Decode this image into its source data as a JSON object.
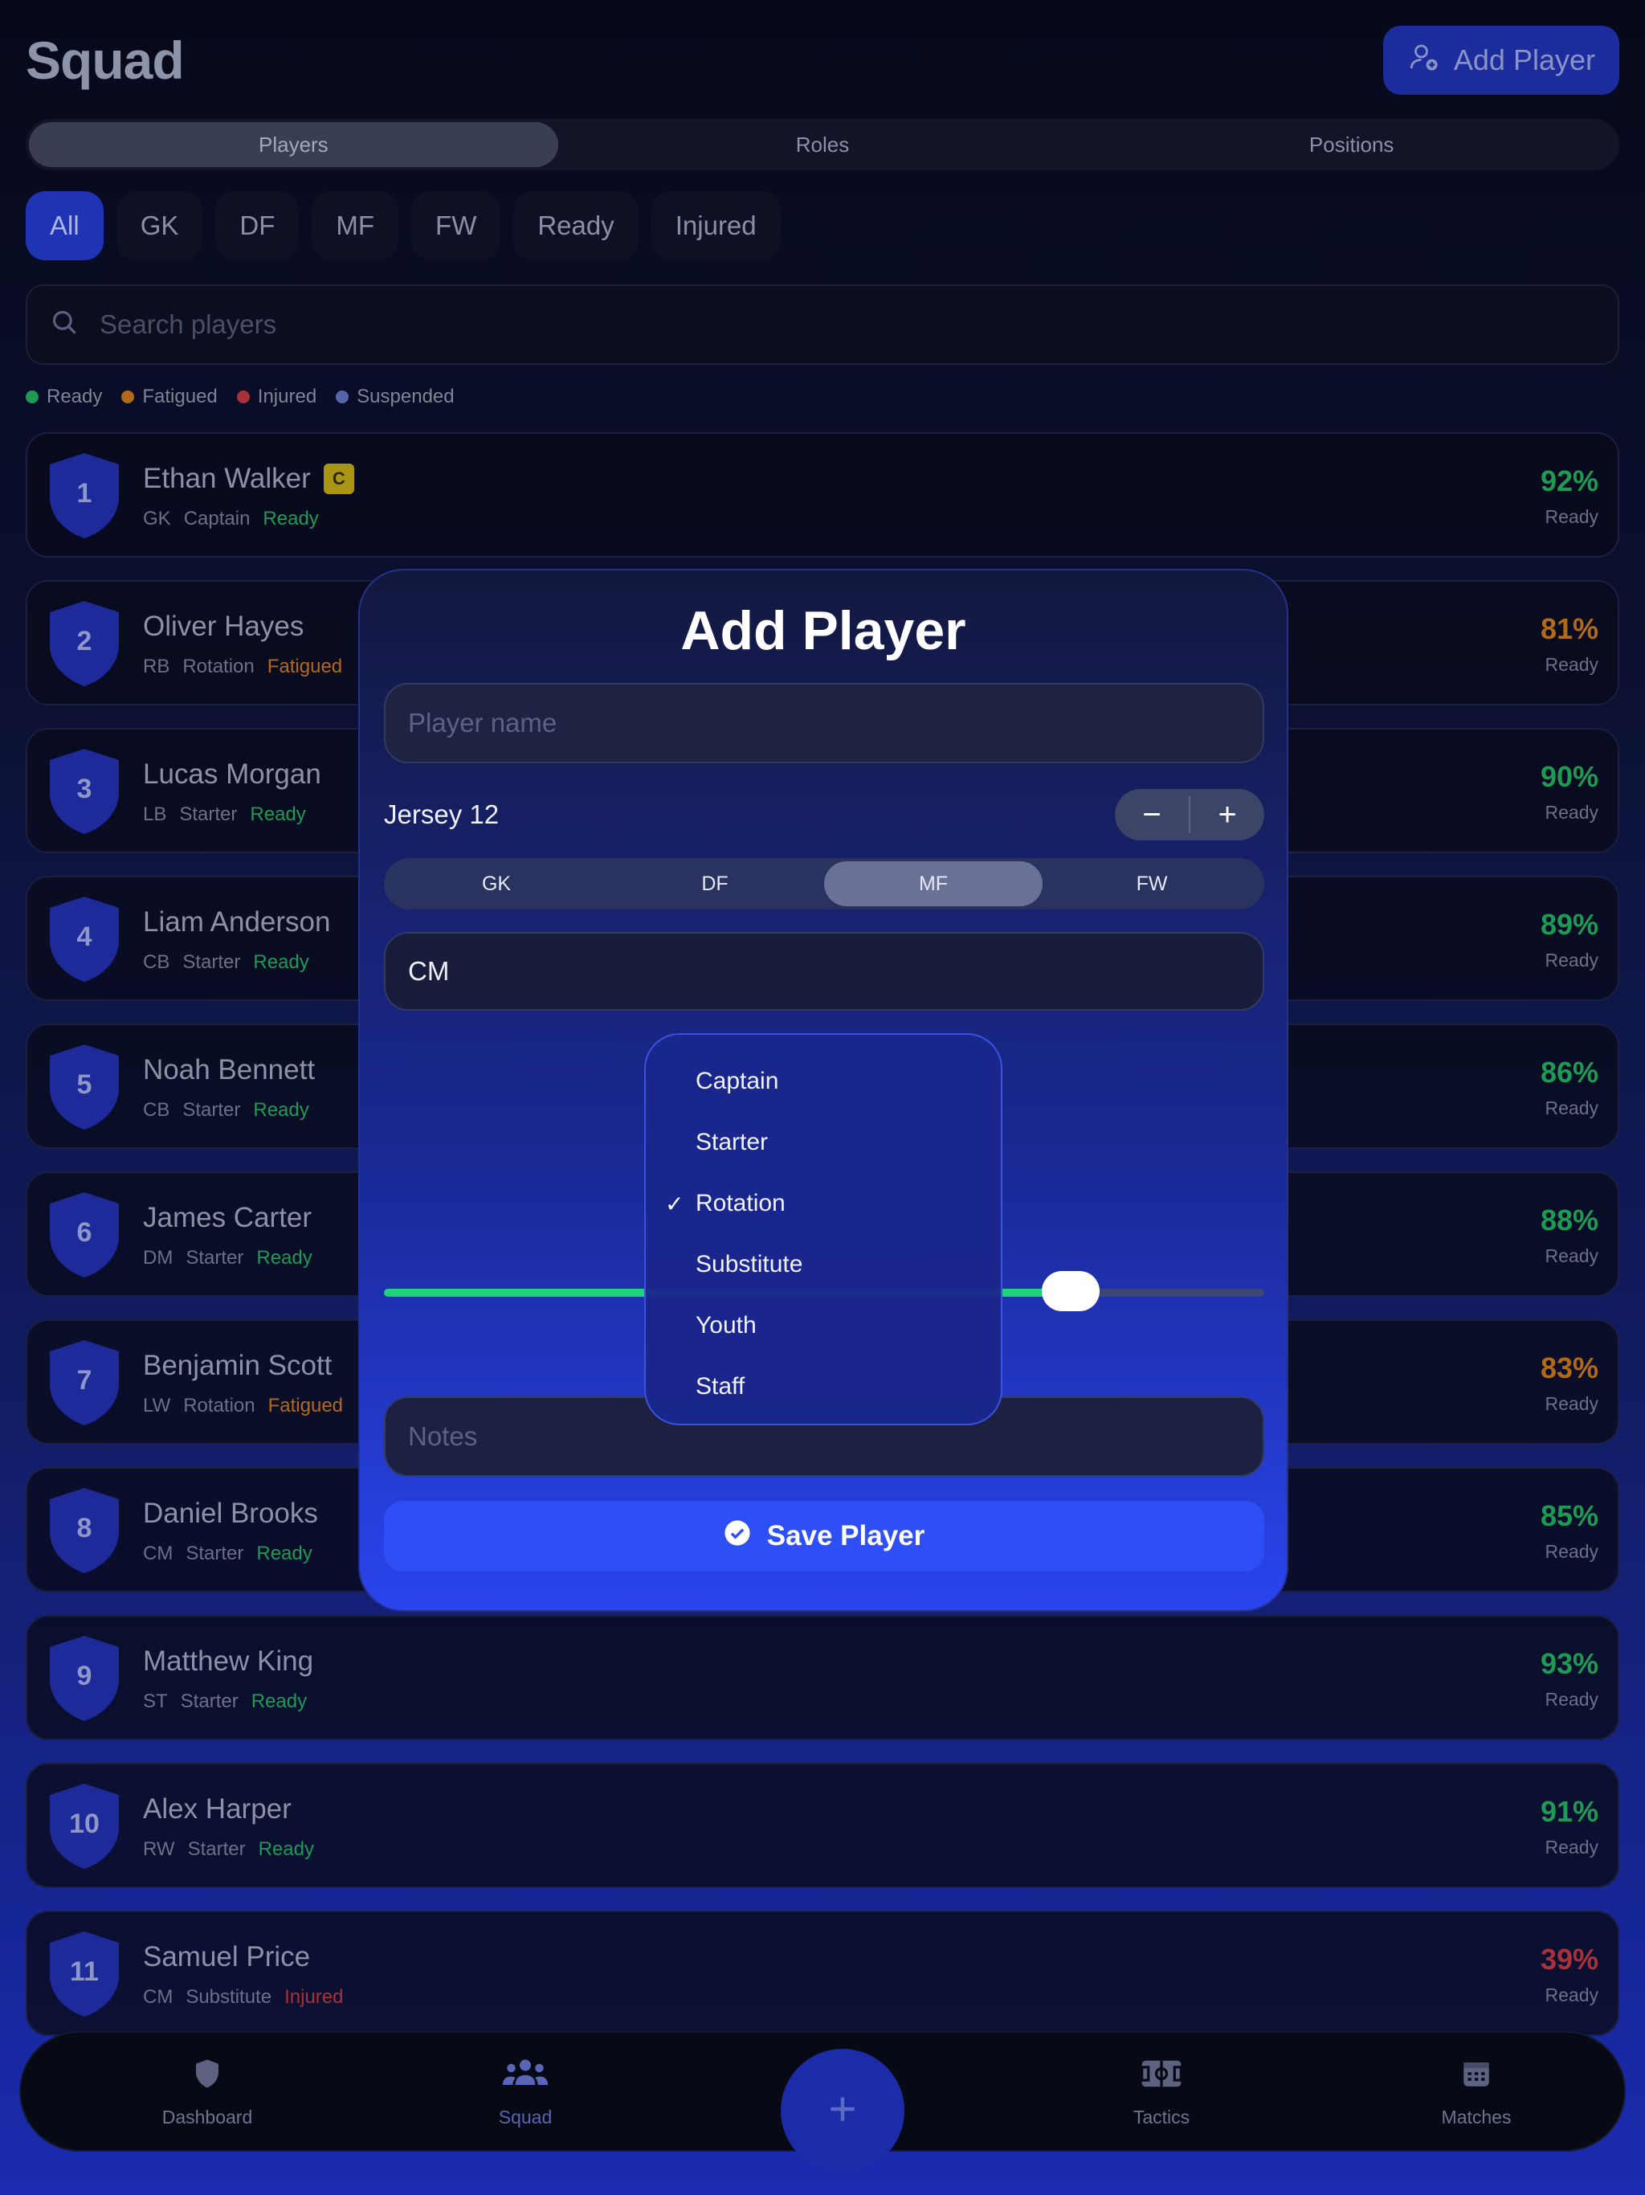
{
  "header": {
    "title": "Squad",
    "add_button_label": "Add Player"
  },
  "tabs": [
    "Players",
    "Roles",
    "Positions"
  ],
  "filters": [
    "All",
    "GK",
    "DF",
    "MF",
    "FW",
    "Ready",
    "Injured"
  ],
  "search": {
    "placeholder": "Search players"
  },
  "legend": [
    {
      "label": "Ready",
      "color": "#1f9a55"
    },
    {
      "label": "Fatigued",
      "color": "#b06a1a"
    },
    {
      "label": "Injured",
      "color": "#a8323a"
    },
    {
      "label": "Suspended",
      "color": "#5864a8"
    }
  ],
  "players": [
    {
      "number": "1",
      "name": "Ethan Walker",
      "badge": "C",
      "pos": "GK",
      "role": "Captain",
      "status": "Ready",
      "pct": "92%",
      "pct_label": "Ready"
    },
    {
      "number": "2",
      "name": "Oliver Hayes",
      "badge": "",
      "pos": "RB",
      "role": "Rotation",
      "status": "Fatigued",
      "pct": "81%",
      "pct_label": "Ready"
    },
    {
      "number": "3",
      "name": "Lucas Morgan",
      "badge": "",
      "pos": "LB",
      "role": "Starter",
      "status": "Ready",
      "pct": "90%",
      "pct_label": "Ready"
    },
    {
      "number": "4",
      "name": "Liam Anderson",
      "badge": "",
      "pos": "CB",
      "role": "Starter",
      "status": "Ready",
      "pct": "89%",
      "pct_label": "Ready"
    },
    {
      "number": "5",
      "name": "Noah Bennett",
      "badge": "",
      "pos": "CB",
      "role": "Starter",
      "status": "Ready",
      "pct": "86%",
      "pct_label": "Ready"
    },
    {
      "number": "6",
      "name": "James Carter",
      "badge": "",
      "pos": "DM",
      "role": "Starter",
      "status": "Ready",
      "pct": "88%",
      "pct_label": "Ready"
    },
    {
      "number": "7",
      "name": "Benjamin Scott",
      "badge": "",
      "pos": "LW",
      "role": "Rotation",
      "status": "Fatigued",
      "pct": "83%",
      "pct_label": "Ready"
    },
    {
      "number": "8",
      "name": "Daniel Brooks",
      "badge": "",
      "pos": "CM",
      "role": "Starter",
      "status": "Ready",
      "pct": "85%",
      "pct_label": "Ready"
    },
    {
      "number": "9",
      "name": "Matthew King",
      "badge": "",
      "pos": "ST",
      "role": "Starter",
      "status": "Ready",
      "pct": "93%",
      "pct_label": "Ready"
    },
    {
      "number": "10",
      "name": "Alex Harper",
      "badge": "",
      "pos": "RW",
      "role": "Starter",
      "status": "Ready",
      "pct": "91%",
      "pct_label": "Ready"
    },
    {
      "number": "11",
      "name": "Samuel Price",
      "badge": "",
      "pos": "CM",
      "role": "Substitute",
      "status": "Injured",
      "pct": "39%",
      "pct_label": "Ready"
    }
  ],
  "status_colors": {
    "Ready": "#1f9a55",
    "Fatigued": "#b06a1a",
    "Injured": "#a8323a"
  },
  "modal": {
    "title": "Add Player",
    "name_placeholder": "Player name",
    "jersey_label": "Jersey 12",
    "stepper_minus": "−",
    "stepper_plus": "+",
    "positions": [
      "GK",
      "DF",
      "MF",
      "FW"
    ],
    "selected_position": "MF",
    "sub_position_value": "CM",
    "fitness_level": 0.78,
    "notes_placeholder": "Notes",
    "save_label": "Save Player"
  },
  "role_dropdown": {
    "options": [
      "Captain",
      "Starter",
      "Rotation",
      "Substitute",
      "Youth",
      "Staff"
    ],
    "selected": "Rotation"
  },
  "nav": [
    {
      "label": "Dashboard",
      "icon": "shield-icon"
    },
    {
      "label": "Squad",
      "icon": "group-icon"
    },
    {
      "label": "Tactics",
      "icon": "pitch-icon"
    },
    {
      "label": "Matches",
      "icon": "calendar-icon"
    }
  ],
  "nav_active": "Squad"
}
